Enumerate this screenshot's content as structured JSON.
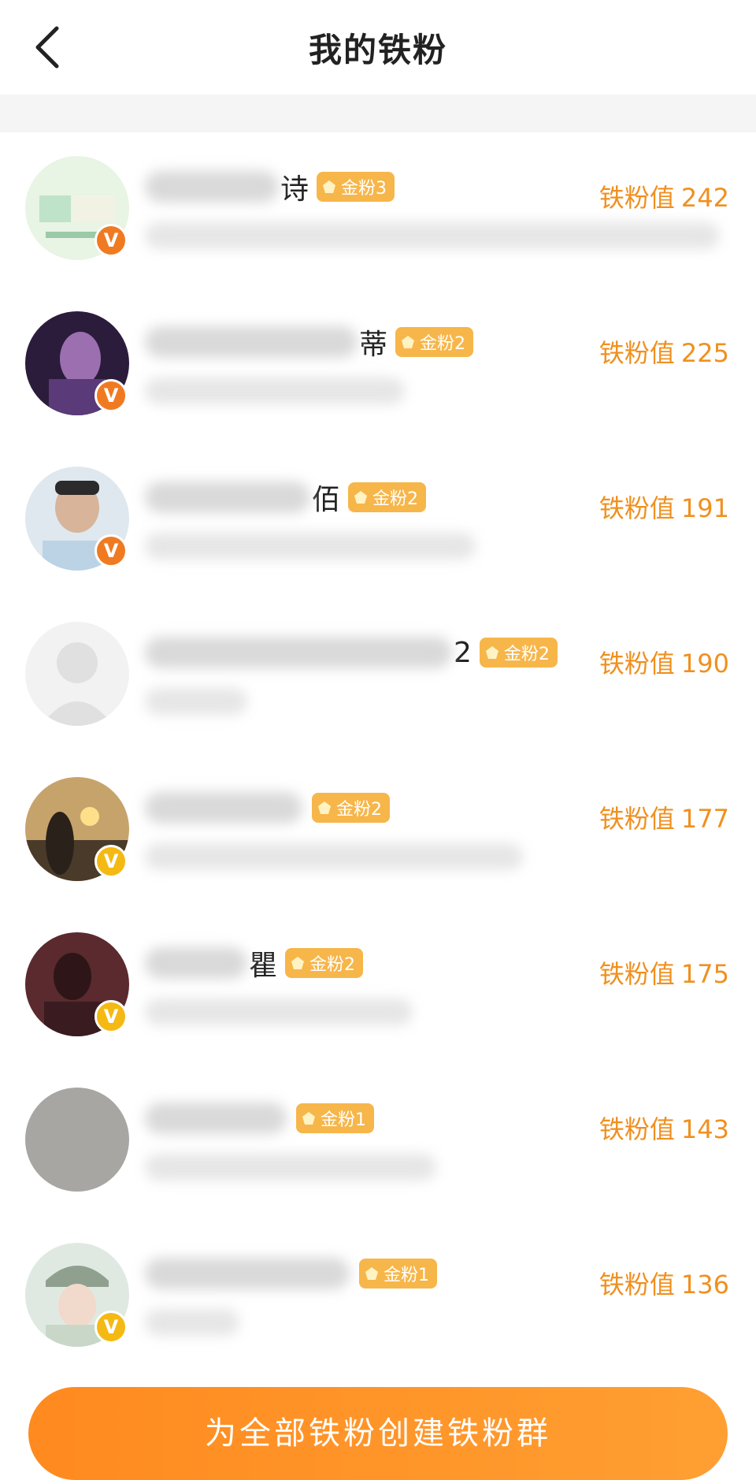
{
  "header": {
    "title": "我的铁粉"
  },
  "accent": "#f0901f",
  "fans": [
    {
      "name_tail": "诗",
      "badge": "金粉3",
      "score_label": "铁粉值",
      "score": "242"
    },
    {
      "name_tail": "蒂",
      "badge": "金粉2",
      "score_label": "铁粉值",
      "score": "225"
    },
    {
      "name_tail": "佰",
      "badge": "金粉2",
      "score_label": "铁粉值",
      "score": "191"
    },
    {
      "name_tail": "2",
      "badge": "金粉2",
      "score_label": "铁粉值",
      "score": "190"
    },
    {
      "name_tail": "",
      "badge": "金粉2",
      "score_label": "铁粉值",
      "score": "177"
    },
    {
      "name_tail": "瞿",
      "badge": "金粉2",
      "score_label": "铁粉值",
      "score": "175"
    },
    {
      "name_tail": "",
      "badge": "金粉1",
      "score_label": "铁粉值",
      "score": "143"
    },
    {
      "name_tail": "",
      "badge": "金粉1",
      "score_label": "铁粉值",
      "score": "136"
    }
  ],
  "cta": {
    "label": "为全部铁粉创建铁粉群"
  }
}
